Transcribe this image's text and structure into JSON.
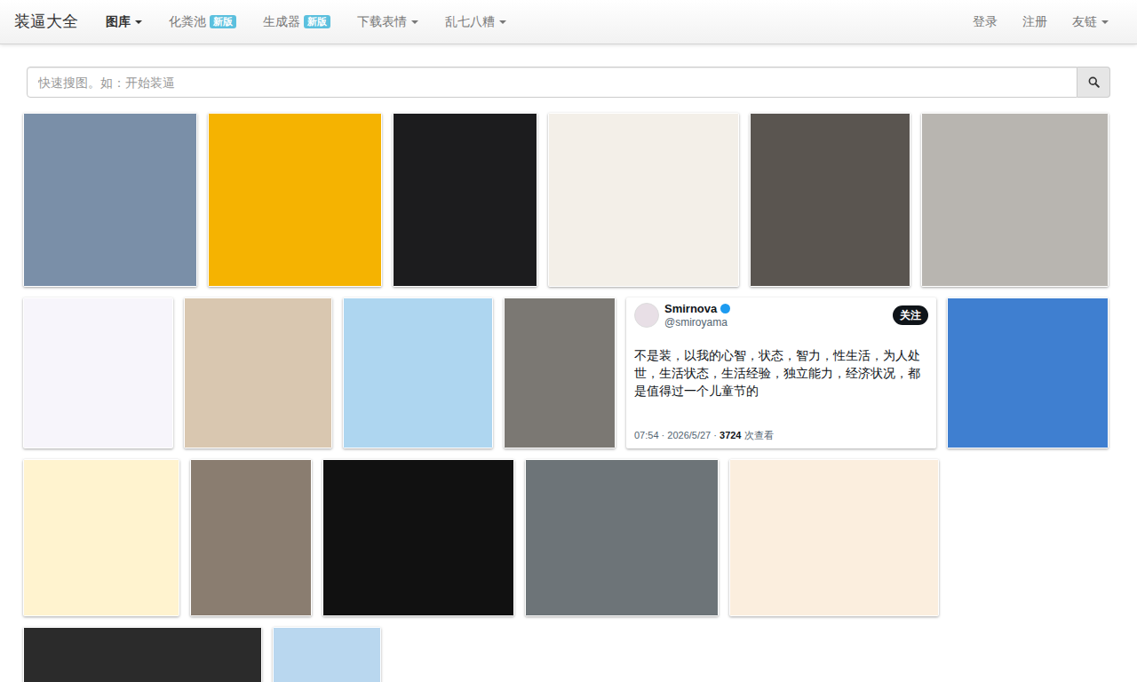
{
  "navbar": {
    "brand": "装逼大全",
    "items": [
      {
        "label": "图库",
        "selected": true,
        "kind": "dropdown"
      },
      {
        "label": "化粪池",
        "selected": false,
        "kind": "badge",
        "badge": "新版"
      },
      {
        "label": "生成器",
        "selected": false,
        "kind": "badge",
        "badge": "新版"
      },
      {
        "label": "下载表情",
        "selected": false,
        "kind": "dropdown"
      },
      {
        "label": "乱七八糟",
        "selected": false,
        "kind": "dropdown"
      }
    ],
    "right_items": [
      {
        "label": "登录",
        "kind": "link"
      },
      {
        "label": "注册",
        "kind": "link"
      },
      {
        "label": "友链",
        "kind": "dropdown"
      }
    ]
  },
  "search": {
    "placeholder": "快速搜图。如：开始装逼"
  },
  "gallery": {
    "rows": [
      [
        {
          "kind": "image",
          "color": "#7a8fa8"
        },
        {
          "kind": "image",
          "color": "#f5b301"
        },
        {
          "kind": "image",
          "color": "#1c1c1e"
        },
        {
          "kind": "image",
          "color": "#f3efe8"
        },
        {
          "kind": "image",
          "color": "#5a5550"
        },
        {
          "kind": "image",
          "color": "#b8b5b0"
        }
      ],
      [
        {
          "kind": "image",
          "color": "#f7f5fb"
        },
        {
          "kind": "image",
          "color": "#d9c7b0"
        },
        {
          "kind": "image",
          "color": "#aed6f0"
        },
        {
          "kind": "image",
          "color": "#7b7873"
        },
        {
          "kind": "tweet",
          "color": "#ffffff",
          "name": "Smirnova",
          "handle": "@smiroyama",
          "follow": "关注",
          "text": "不是装，以我的心智，状态，智力，性生活，为人处世，生活状态，生活经验，独立能力，经济状况，都是值得过一个儿童节的",
          "time": "07:54 · 2026/5/27 · ",
          "views": "3724",
          "views_label": " 次查看"
        },
        {
          "kind": "image",
          "color": "#3f7fd0"
        }
      ],
      [
        {
          "kind": "image",
          "color": "#fff3cf"
        },
        {
          "kind": "image",
          "color": "#8a7d70"
        },
        {
          "kind": "image",
          "color": "#111111"
        },
        {
          "kind": "image",
          "color": "#6d7478"
        },
        {
          "kind": "image",
          "color": "#fbeede"
        }
      ],
      [
        {
          "kind": "image",
          "color": "#2b2b2b"
        },
        {
          "kind": "image",
          "color": "#b9d7ef"
        }
      ]
    ]
  }
}
